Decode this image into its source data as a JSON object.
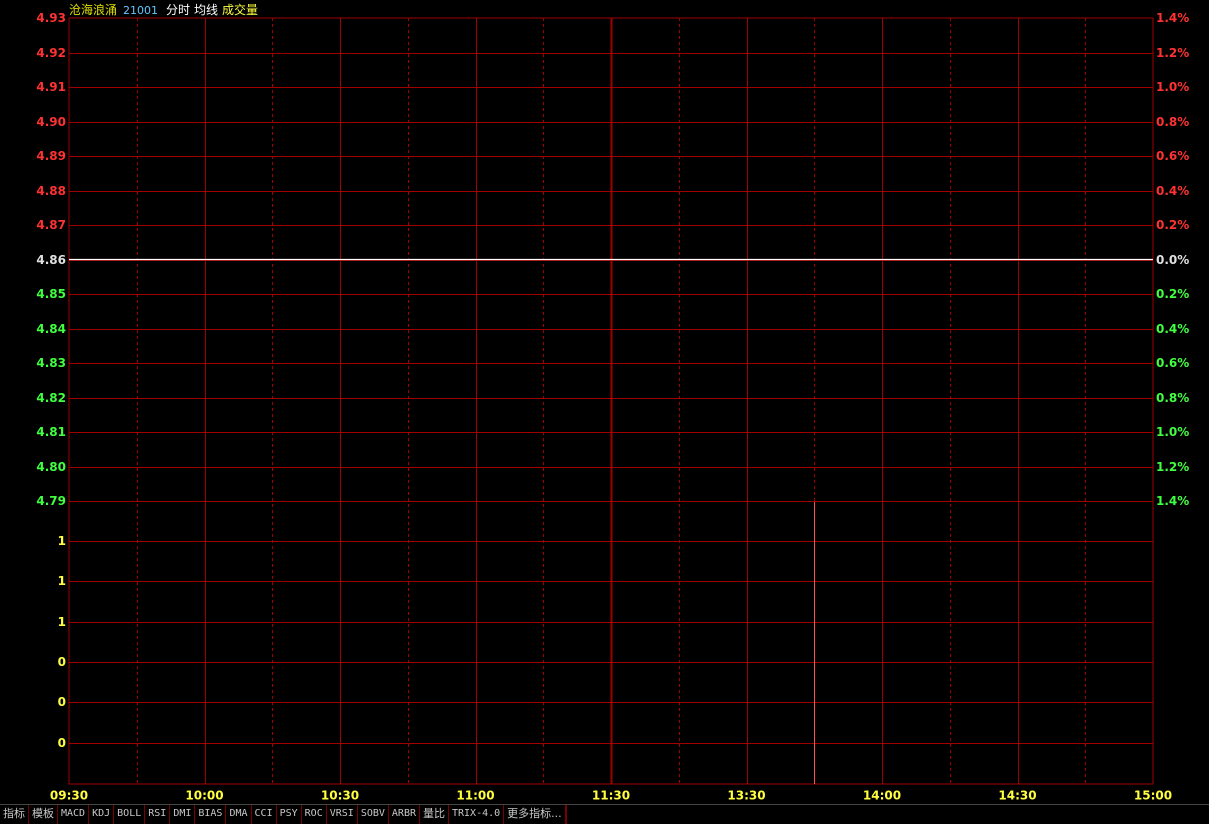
{
  "header": {
    "name": "沧海浪涌",
    "code": "21001",
    "mode": "分时",
    "avg_label": "均线",
    "volume_label": "成交量"
  },
  "colors": {
    "grid": "#a00000",
    "up": "#ff3232",
    "down": "#40ff40",
    "neutral": "#e0e0e0",
    "volume_axis": "#ffff40",
    "time_axis": "#ffff40",
    "price_line": "#ffffff",
    "volume_bar": "#ff5050"
  },
  "chart_data": {
    "type": "line",
    "price_axis": {
      "labels": [
        "4.93",
        "4.92",
        "4.91",
        "4.90",
        "4.89",
        "4.88",
        "4.87",
        "4.86",
        "4.85",
        "4.84",
        "4.83",
        "4.82",
        "4.81",
        "4.80",
        "4.79"
      ],
      "values": [
        4.93,
        4.92,
        4.91,
        4.9,
        4.89,
        4.88,
        4.87,
        4.86,
        4.85,
        4.84,
        4.83,
        4.82,
        4.81,
        4.8,
        4.79
      ],
      "ylim": [
        4.79,
        4.93
      ],
      "reference": 4.86
    },
    "percent_axis": {
      "labels": [
        "1.4%",
        "1.2%",
        "1.0%",
        "0.8%",
        "0.6%",
        "0.4%",
        "0.2%",
        "0.0%",
        "0.2%",
        "0.4%",
        "0.6%",
        "0.8%",
        "1.0%",
        "1.2%",
        "1.4%"
      ]
    },
    "volume_axis": {
      "labels": [
        "1",
        "1",
        "1",
        "0",
        "0",
        "0"
      ]
    },
    "time_axis": {
      "labels": [
        "09:30",
        "10:00",
        "10:30",
        "11:00",
        "11:30",
        "13:30",
        "14:00",
        "14:30",
        "15:00"
      ],
      "minutes": [
        0,
        30,
        60,
        90,
        120,
        150,
        180,
        210,
        240
      ]
    },
    "series": [
      {
        "x": [
          0,
          240
        ],
        "y": [
          4.86,
          4.86
        ]
      }
    ],
    "volume": [
      {
        "minute": 165,
        "value": 1
      }
    ],
    "grid": true
  },
  "tabs": [
    "指标",
    "模板",
    "MACD",
    "KDJ",
    "BOLL",
    "RSI",
    "DMI",
    "BIAS",
    "DMA",
    "CCI",
    "PSY",
    "ROC",
    "VRSI",
    "SOBV",
    "ARBR",
    "量比",
    "TRIX-4.0",
    "更多指标..."
  ]
}
